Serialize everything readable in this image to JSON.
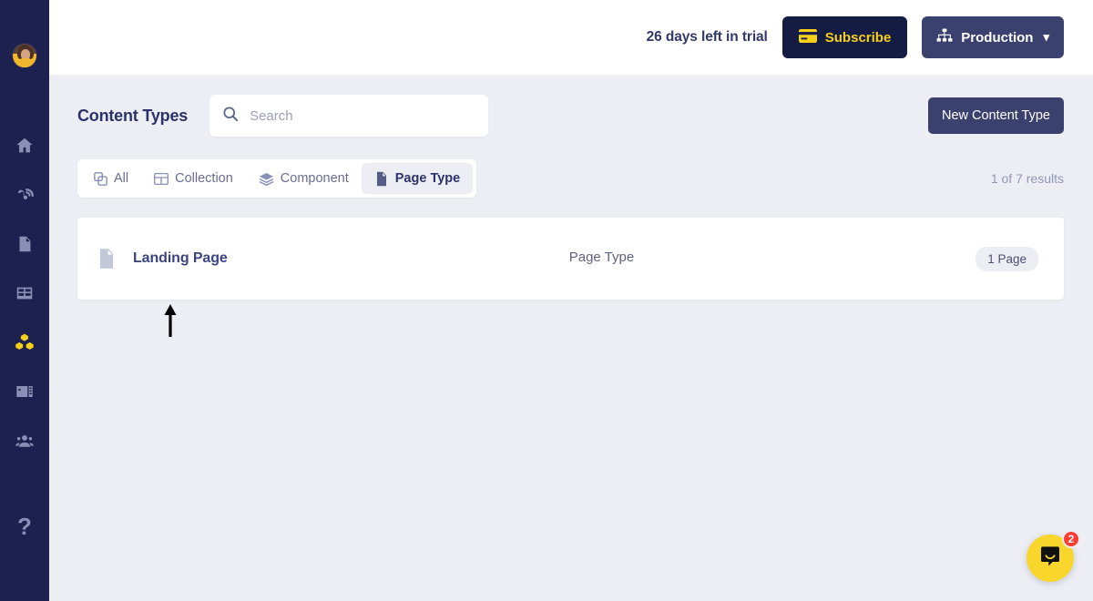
{
  "sidebar": {
    "avatar": {
      "name": "user-avatar",
      "alt": "User profile photo"
    },
    "items": [
      {
        "icon": "home-icon",
        "name": "sidebar-item-home",
        "active": false
      },
      {
        "icon": "blog-icon",
        "name": "sidebar-item-blog",
        "active": false
      },
      {
        "icon": "page-icon",
        "name": "sidebar-item-pages",
        "active": false
      },
      {
        "icon": "table-icon",
        "name": "sidebar-item-collections",
        "active": false
      },
      {
        "icon": "blocks-icon",
        "name": "sidebar-item-content-types",
        "active": true
      },
      {
        "icon": "media-icon",
        "name": "sidebar-item-media",
        "active": false
      },
      {
        "icon": "users-icon",
        "name": "sidebar-item-users",
        "active": false
      }
    ],
    "help_label": "?",
    "accent_active": "#f5d018",
    "background": "#1c2150"
  },
  "topbar": {
    "trial_text": "26 days left in trial",
    "subscribe_label": "Subscribe",
    "subscribe_icon": "credit-card-icon",
    "subscribe_color": "#f6d117",
    "environment_label": "Production",
    "environment_icon": "sitemap-icon",
    "environment_chevron": "chevron-down-icon"
  },
  "header": {
    "title": "Content Types",
    "search": {
      "value": "",
      "placeholder": "Search",
      "icon": "search-icon"
    },
    "new_button_label": "New Content Type"
  },
  "filters": {
    "tabs": [
      {
        "label": "All",
        "icon": "copy-icon",
        "active": false
      },
      {
        "label": "Collection",
        "icon": "table-icon",
        "active": false
      },
      {
        "label": "Component",
        "icon": "layers-icon",
        "active": false
      },
      {
        "label": "Page Type",
        "icon": "page-icon",
        "active": true
      }
    ],
    "results_text": "1 of 7 results"
  },
  "content_list": {
    "rows": [
      {
        "name": "Landing Page",
        "icon": "page-icon",
        "kind": "Page Type",
        "badge": "1 Page"
      }
    ]
  },
  "annotation": {
    "arrow": {
      "name": "pointer-arrow",
      "direction": "up",
      "color": "#000000"
    }
  },
  "chat_widget": {
    "icon": "chat-smiley-icon",
    "badge_count": "2",
    "color": "#f8d62b",
    "badge_color": "#ff3b30"
  }
}
